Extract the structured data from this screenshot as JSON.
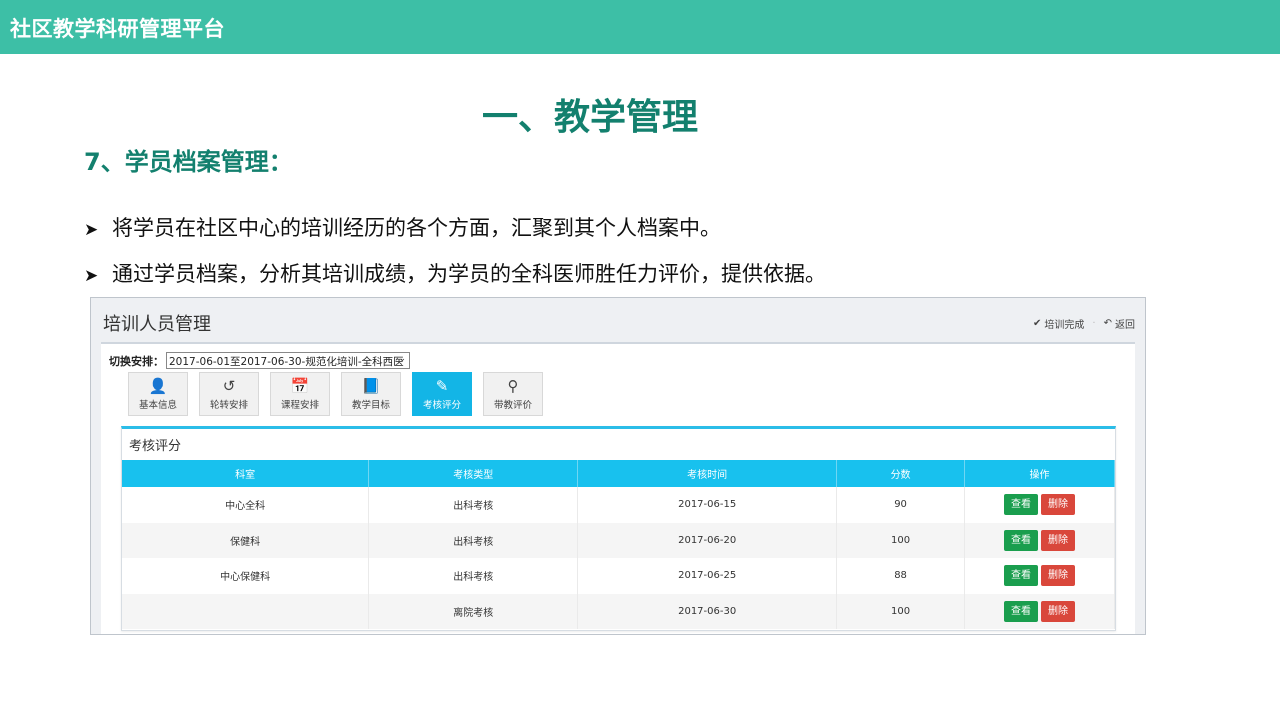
{
  "app": {
    "title": "社区教学科研管理平台"
  },
  "slide": {
    "main_title": "一、教学管理",
    "section_title": "7、学员档案管理：",
    "bullets": [
      "将学员在社区中心的培训经历的各个方面，汇聚到其个人档案中。",
      "通过学员档案，分析其培训成绩，为学员的全科医师胜任力评价，提供依据。"
    ]
  },
  "screenshot": {
    "header": {
      "title": "培训人员管理",
      "complete_label": "培训完成",
      "back_label": "返回"
    },
    "switch": {
      "label": "切换安排：",
      "value": "2017-06-01至2017-06-30-规范化培训-全科西医"
    },
    "tabs": [
      {
        "label": "基本信息",
        "icon": "user-icon",
        "glyph": "👤"
      },
      {
        "label": "轮转安排",
        "icon": "history-icon",
        "glyph": "↺"
      },
      {
        "label": "课程安排",
        "icon": "calendar-icon",
        "glyph": "📅"
      },
      {
        "label": "教学目标",
        "icon": "book-icon",
        "glyph": "📘"
      },
      {
        "label": "考核评分",
        "icon": "edit-icon",
        "glyph": "✎"
      },
      {
        "label": "带教评价",
        "icon": "binoculars-icon",
        "glyph": "⚲"
      }
    ],
    "active_tab": "考核评分",
    "card": {
      "title": "考核评分",
      "columns": [
        "科室",
        "考核类型",
        "考核时间",
        "分数",
        "操作"
      ],
      "rows": [
        {
          "dept": "中心全科",
          "type": "出科考核",
          "date": "2017-06-15",
          "score": "90"
        },
        {
          "dept": "保健科",
          "type": "出科考核",
          "date": "2017-06-20",
          "score": "100"
        },
        {
          "dept": "中心保健科",
          "type": "出科考核",
          "date": "2017-06-25",
          "score": "88"
        },
        {
          "dept": "",
          "type": "离院考核",
          "date": "2017-06-30",
          "score": "100"
        }
      ],
      "view_label": "查看",
      "delete_label": "删除"
    }
  },
  "colors": {
    "topbar": "#3dbfa6",
    "title_green": "#13806e",
    "tab_active": "#13b5e6",
    "table_header": "#18c1ee",
    "view_button": "#1a9e4e",
    "delete_button": "#d9473b"
  }
}
